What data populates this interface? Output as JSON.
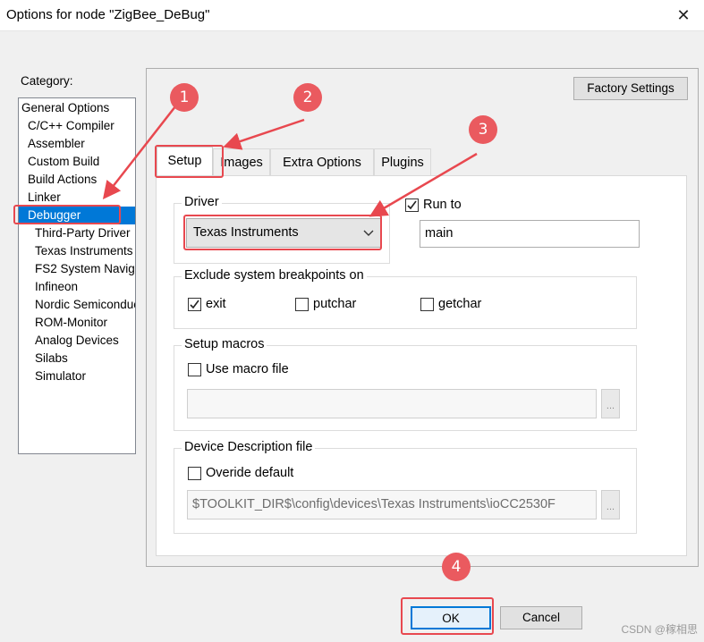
{
  "window": {
    "title": "Options for node \"ZigBee_DeBug\"",
    "close_glyph": "✕"
  },
  "category": {
    "label": "Category:",
    "items": [
      {
        "label": "General Options"
      },
      {
        "label": "C/C++ Compiler"
      },
      {
        "label": "Assembler"
      },
      {
        "label": "Custom Build"
      },
      {
        "label": "Build Actions"
      },
      {
        "label": "Linker"
      },
      {
        "label": "Debugger",
        "selected": true
      },
      {
        "label": "Third-Party Driver"
      },
      {
        "label": "Texas Instruments"
      },
      {
        "label": "FS2 System Navig"
      },
      {
        "label": "Infineon"
      },
      {
        "label": "Nordic Semiconduc"
      },
      {
        "label": "ROM-Monitor"
      },
      {
        "label": "Analog Devices"
      },
      {
        "label": "Silabs"
      },
      {
        "label": "Simulator"
      }
    ]
  },
  "factory_settings": "Factory Settings",
  "tabs": [
    {
      "label": "Setup",
      "active": true
    },
    {
      "label": "Images"
    },
    {
      "label": "Extra Options"
    },
    {
      "label": "Plugins"
    }
  ],
  "driver": {
    "group_label": "Driver",
    "selected": "Texas Instruments"
  },
  "run_to": {
    "label": "Run to",
    "checked": true,
    "value": "main"
  },
  "breakpoints": {
    "group_label": "Exclude system breakpoints on",
    "exit": {
      "label": "exit",
      "checked": true
    },
    "putchar": {
      "label": "putchar",
      "checked": false
    },
    "getchar": {
      "label": "getchar",
      "checked": false
    }
  },
  "macros": {
    "group_label": "Setup macros",
    "use_macro": {
      "label": "Use macro file",
      "checked": false
    },
    "path": "",
    "browse": "..."
  },
  "device": {
    "group_label": "Device Description file",
    "override": {
      "label": "Overide default",
      "checked": false
    },
    "path": "$TOOLKIT_DIR$\\config\\devices\\Texas Instruments\\ioCC2530F",
    "browse": "..."
  },
  "buttons": {
    "ok": "OK",
    "cancel": "Cancel"
  },
  "annotations": [
    "1",
    "2",
    "3",
    "4"
  ],
  "watermark": "CSDN @稼相思",
  "colors": {
    "accent": "#0078d7",
    "annotation": "#e8484f"
  }
}
